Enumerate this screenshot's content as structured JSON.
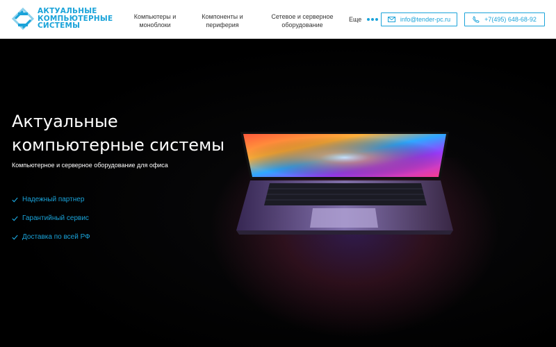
{
  "brand": {
    "name_lines": [
      "АКТУАЛЬНЫЕ",
      "КОМПЬЮТЕРНЫЕ",
      "СИСТЕМЫ"
    ],
    "accent": "#1aa3d9"
  },
  "nav": {
    "computers": [
      "Компьютеры и",
      "моноблоки"
    ],
    "components": [
      "Компоненты и",
      "периферия"
    ],
    "network": [
      "Сетевое и серверное",
      "оборудование"
    ],
    "more": "Еще"
  },
  "contacts": {
    "email": "info@tender-pc.ru",
    "phone": "+7(495) 648-68-92"
  },
  "hero": {
    "title_lines": [
      "Актуальные",
      "компьютерные системы"
    ],
    "subtitle": "Компьютерное и серверное оборудование для офиса",
    "features": [
      "Надежный партнер",
      "Гарантийный сервис",
      "Доставка по всей РФ"
    ]
  },
  "icons": {
    "logo": "logo-icon",
    "email": "envelope-icon",
    "phone": "phone-icon",
    "more": "dots-icon",
    "feature": "check-icon"
  }
}
